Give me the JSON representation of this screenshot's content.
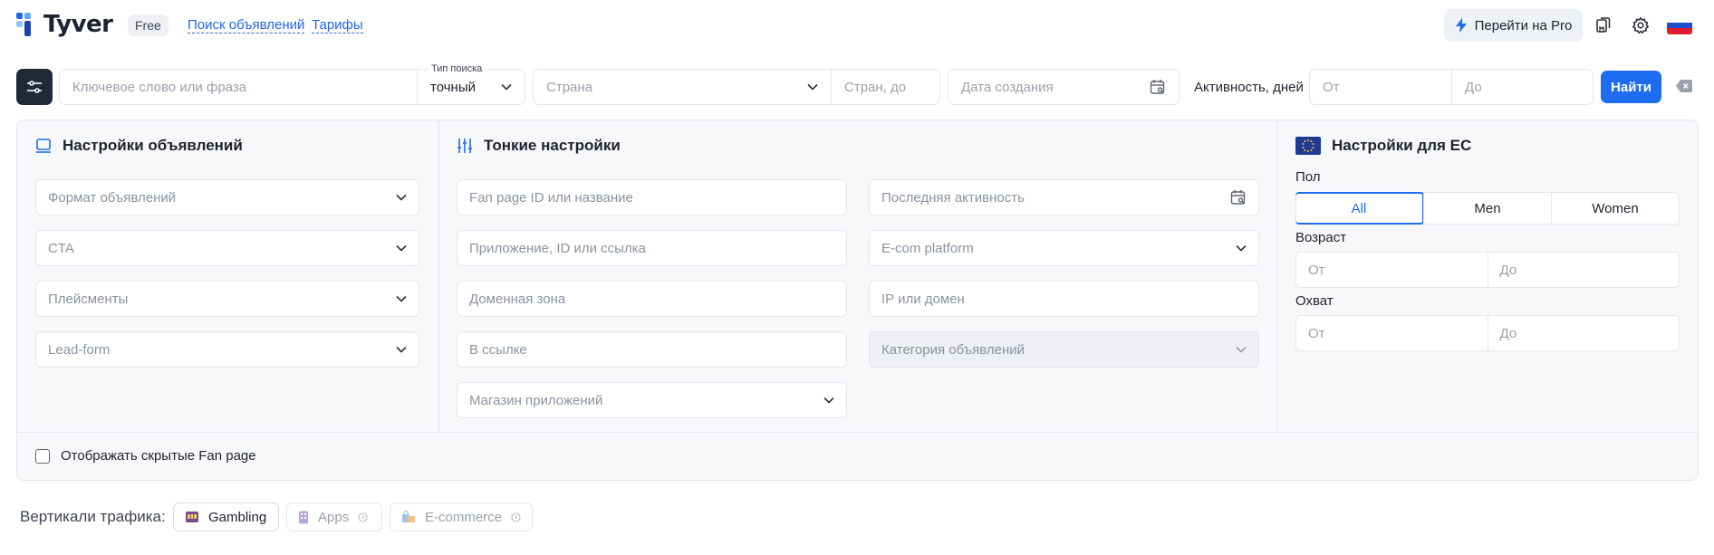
{
  "header": {
    "logo_text": "Tyver",
    "plan_badge": "Free",
    "links": [
      "Поиск объявлений",
      "Тарифы"
    ],
    "pro_button": "Перейти на Pro"
  },
  "search": {
    "keyword_placeholder": "Ключевое слово или фраза",
    "search_type_label": "Тип поиска",
    "search_type_value": "точный",
    "country_placeholder": "Страна",
    "countries_upto_placeholder": "Стран, до",
    "created_date_placeholder": "Дата создания",
    "activity_label": "Активность, дней",
    "activity_from": "От",
    "activity_to": "До",
    "find_button": "Найти"
  },
  "ad_settings": {
    "title": "Настройки объявлений",
    "fields": [
      "Формат объявлений",
      "CTA",
      "Плейсменты",
      "Lead-form"
    ]
  },
  "fine_settings": {
    "title": "Тонкие настройки",
    "left_fields": [
      "Fan page ID или название",
      "Приложение, ID или ссылка",
      "Доменная зона",
      "В ссылке",
      "Магазин приложений"
    ],
    "right_fields": [
      "Последняя активность",
      "E-com platform",
      "IP или домен",
      "Категория объявлений"
    ]
  },
  "eu_settings": {
    "title": "Настройки для ЕС",
    "gender_label": "Пол",
    "gender_options": [
      "All",
      "Men",
      "Women"
    ],
    "gender_selected": "All",
    "age_label": "Возраст",
    "age_from": "От",
    "age_to": "До",
    "reach_label": "Охват",
    "reach_from": "От",
    "reach_to": "До"
  },
  "show_hidden_label": "Отображать скрытые Fan page",
  "verticals": {
    "label": "Вертикали трафика:",
    "chips": [
      "Gambling",
      "Apps",
      "E-commerce"
    ]
  },
  "colors": {
    "accent": "#1d6cf2",
    "dark_button": "#1f2937",
    "panel_bg": "#f7f8fa",
    "border": "#e3e6ec"
  }
}
